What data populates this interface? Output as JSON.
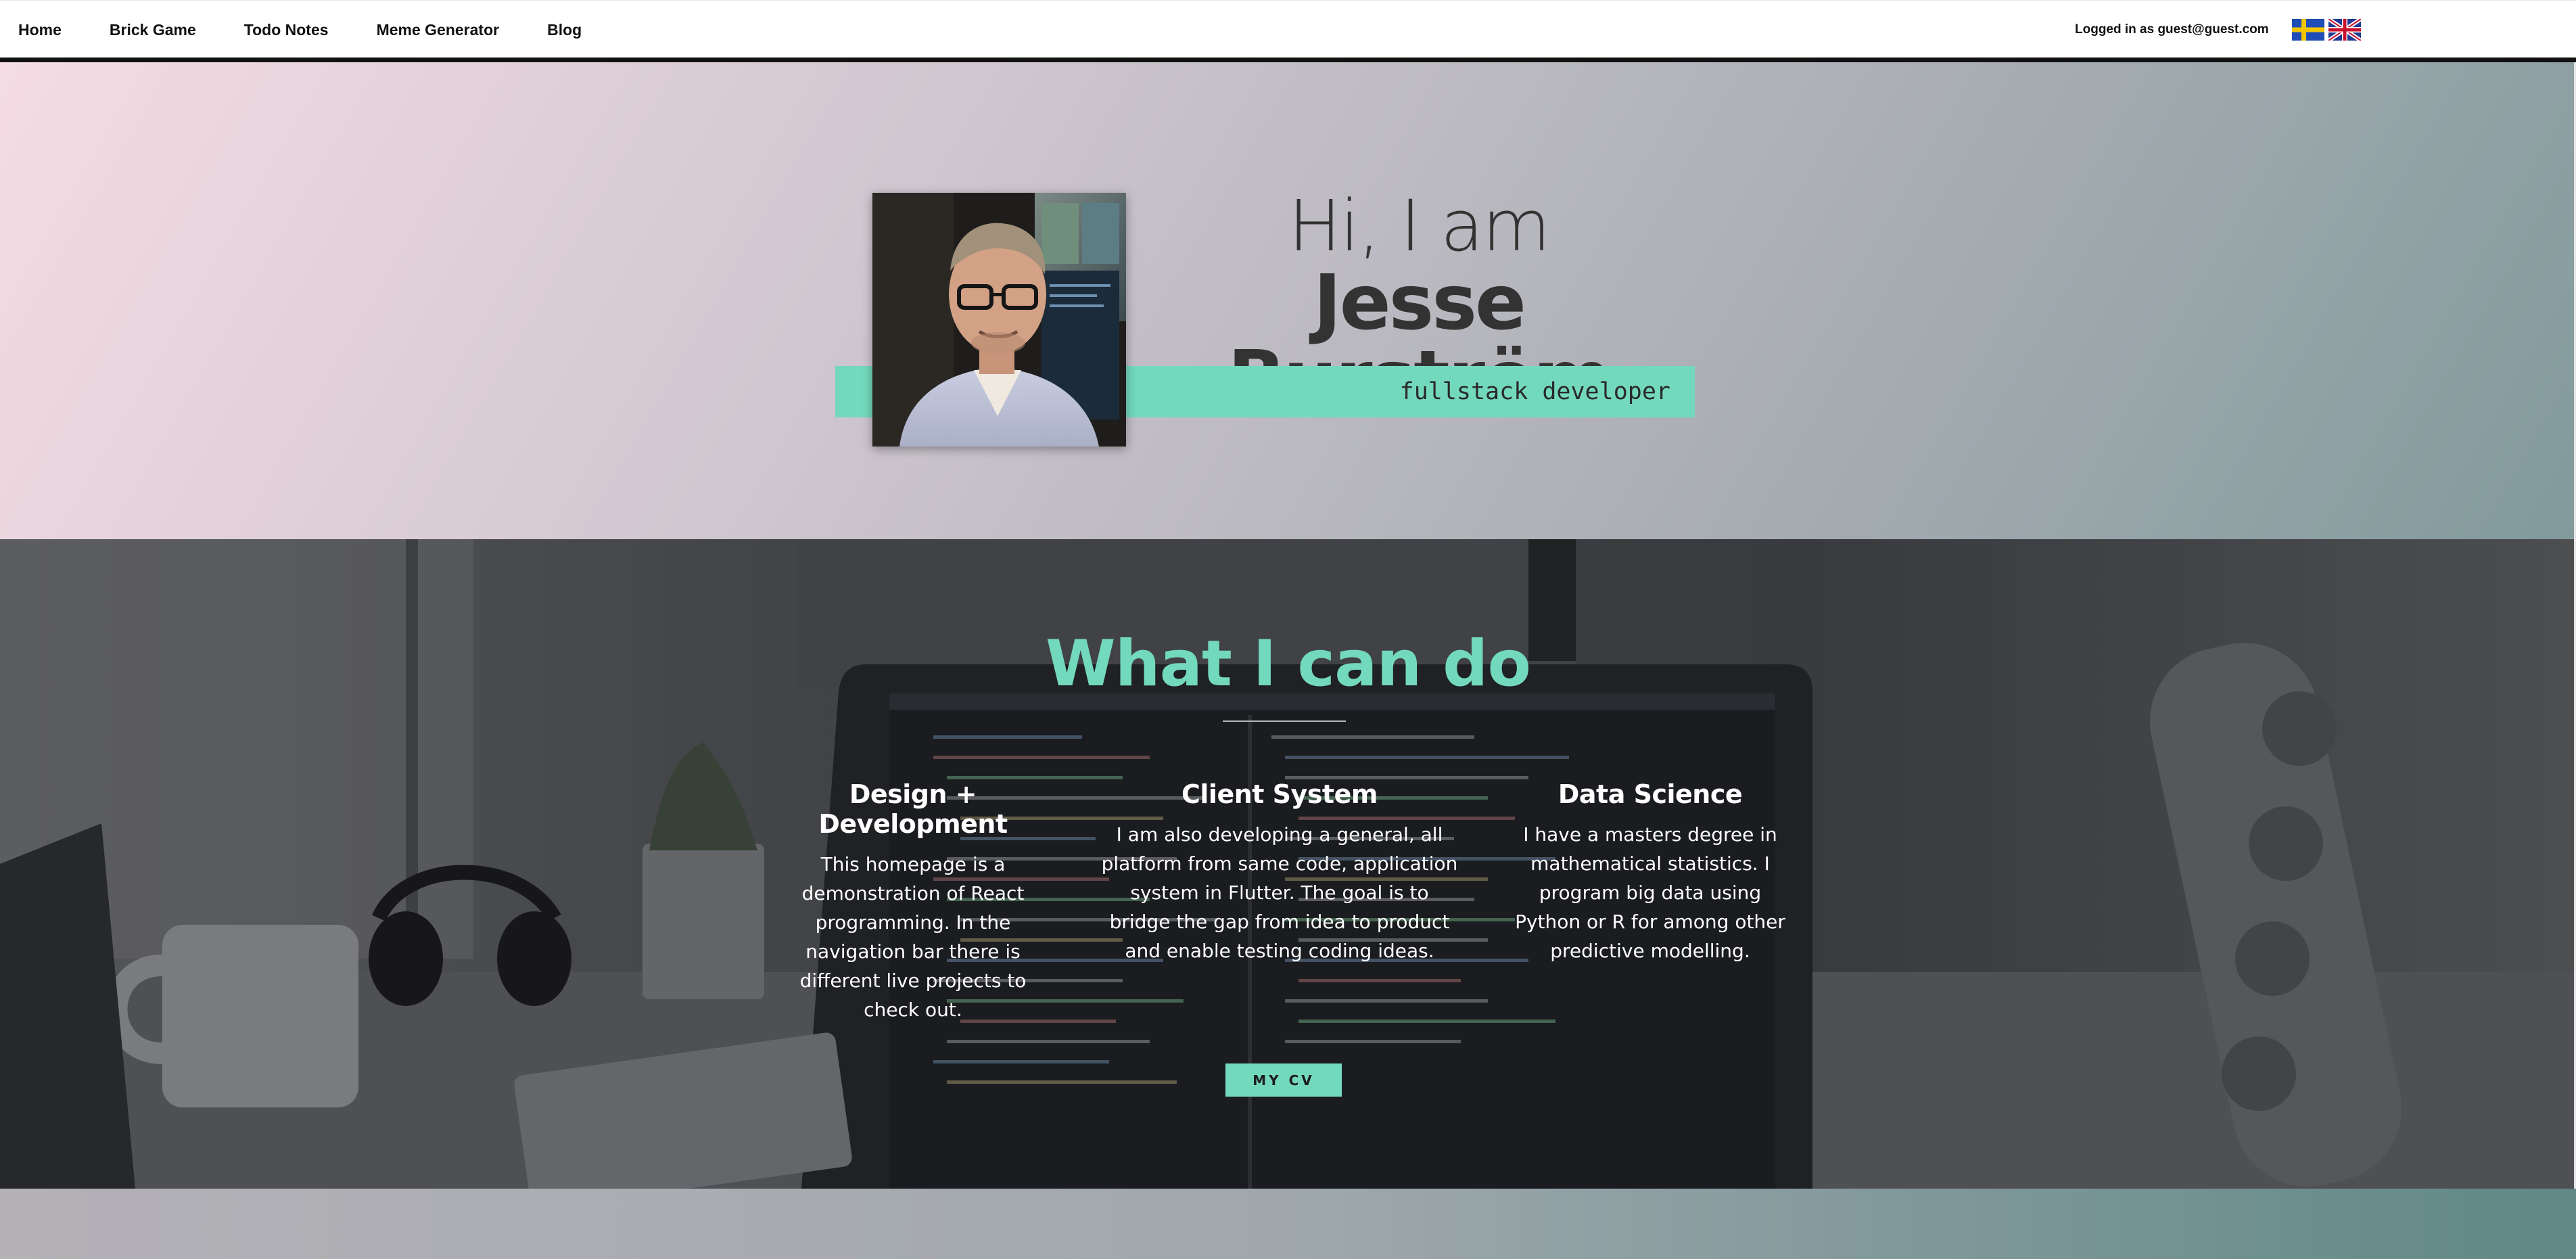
{
  "nav": {
    "links": [
      "Home",
      "Brick Game",
      "Todo Notes",
      "Meme Generator",
      "Blog"
    ],
    "login_status": "Logged in as guest@guest.com",
    "flags": [
      "swedish-flag",
      "uk-flag"
    ]
  },
  "hero": {
    "greeting": "Hi, I am",
    "name": "Jesse Burström",
    "role": "fullstack developer"
  },
  "skills": {
    "title": "What I can do",
    "columns": [
      {
        "heading": "Design + Development",
        "text": "This homepage is a demonstration of React programming. In the navigation bar there is different live projects to check out."
      },
      {
        "heading": "Client System",
        "text": "I am also developing a general, all platform from same code, application system in Flutter. The goal is to bridge the gap from idea to product and enable testing coding ideas."
      },
      {
        "heading": "Data Science",
        "text": "I have a masters degree in mathematical statistics. I program big data using Python or R for among other predictive modelling."
      }
    ],
    "cv_button": "MY CV"
  },
  "colors": {
    "accent": "#73d9bc",
    "text_dark": "#333333",
    "nav_border": "#111111"
  }
}
